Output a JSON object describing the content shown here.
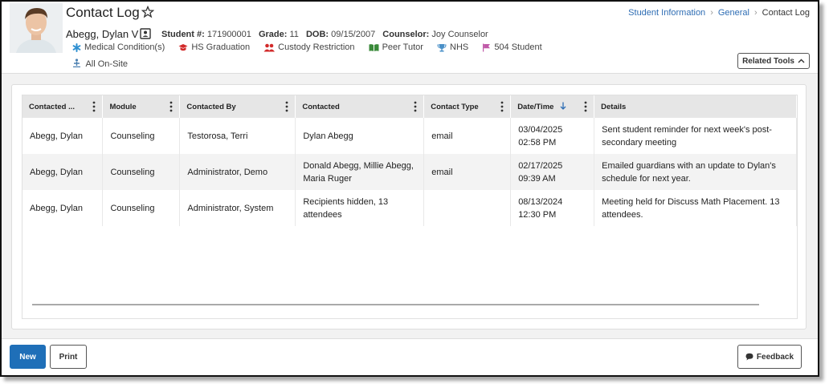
{
  "header": {
    "title": "Contact Log",
    "student_name": "Abegg, Dylan V",
    "student_num_label": "Student #:",
    "student_num": "171900001",
    "grade_label": "Grade:",
    "grade": "11",
    "dob_label": "DOB:",
    "dob": "09/15/2007",
    "counselor_label": "Counselor:",
    "counselor": "Joy Counselor",
    "flags": [
      {
        "label": "Medical Condition(s)",
        "icon": "asterisk-icon",
        "color": "#2e8fd1"
      },
      {
        "label": "HS Graduation",
        "icon": "graduation-cap-icon",
        "color": "#d22a2a"
      },
      {
        "label": "Custody Restriction",
        "icon": "people-icon",
        "color": "#d22a2a"
      },
      {
        "label": "Peer Tutor",
        "icon": "book-icon",
        "color": "#3a8a3a"
      },
      {
        "label": "NHS",
        "icon": "trophy-icon",
        "color": "#4a90c8"
      },
      {
        "label": "504 Student",
        "icon": "flag-icon",
        "color": "#c05aa8"
      }
    ],
    "onsite_label": "All On-Site",
    "related_tools": "Related Tools"
  },
  "breadcrumb": [
    "Student Information",
    "General",
    "Contact Log"
  ],
  "table": {
    "columns": [
      "Contacted ...",
      "Module",
      "Contacted By",
      "Contacted",
      "Contact Type",
      "Date/Time",
      "Details"
    ],
    "rows": [
      [
        "Abegg, Dylan",
        "Counseling",
        "Testorosa, Terri",
        "Dylan Abegg",
        "email",
        "03/04/2025 02:58 PM",
        "Sent student reminder for next week's post-secondary meeting"
      ],
      [
        "Abegg, Dylan",
        "Counseling",
        "Administrator, Demo",
        "Donald Abegg, Millie Abegg, Maria Ruger",
        "email",
        "02/17/2025 09:39 AM",
        "Emailed guardians with an update to Dylan's schedule for next year."
      ],
      [
        "Abegg, Dylan",
        "Counseling",
        "Administrator, System",
        "Recipients hidden, 13 attendees",
        "",
        "08/13/2024 12:30 PM",
        "Meeting held for Discuss Math Placement. 13 attendees."
      ]
    ]
  },
  "footer": {
    "new_label": "New",
    "print_label": "Print",
    "feedback_label": "Feedback"
  },
  "colors": {
    "primary": "#1f6fb8",
    "link": "#2e6db4",
    "header_bg": "#e6e6e6"
  }
}
